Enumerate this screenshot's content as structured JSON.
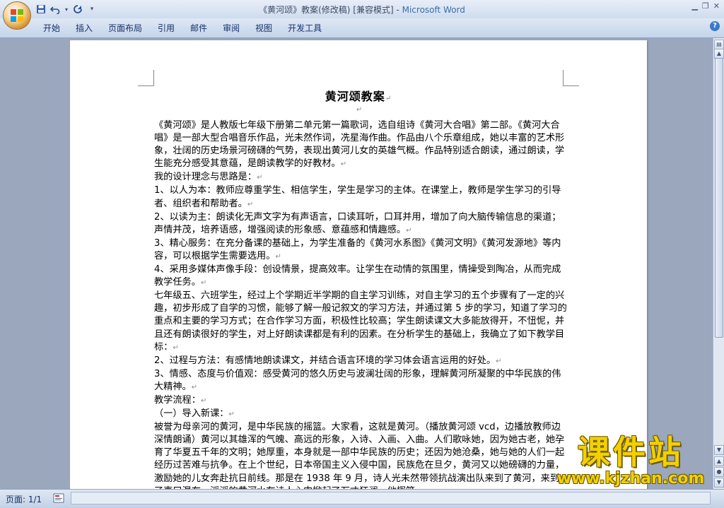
{
  "window": {
    "doc_name": "《黄河颂》教案(修改稿) [兼容模式] - ",
    "app_name": "Microsoft Word"
  },
  "ribbon": {
    "tabs": [
      "开始",
      "插入",
      "页面布局",
      "引用",
      "邮件",
      "审阅",
      "视图",
      "开发工具"
    ]
  },
  "icons": {
    "office_button": "office-logo-icon",
    "save": "save-icon",
    "undo": "undo-icon",
    "redo": "redo-icon",
    "customize": "customize-qat-icon",
    "help": "help-icon"
  },
  "document": {
    "title": "黄河颂教案",
    "paragraphs": [
      "《黄河颂》是人教版七年级下册第二单元第一篇歌词，选自组诗《黄河大合唱》第二部。《黄河大合唱》是一部大型合唱音乐作品，光未然作词，冼星海作曲。作品由八个乐章组成，她以丰富的艺术形象，壮阔的历史场景河磅礴的气势，表现出黄河儿女的英雄气概。作品特别适合朗读，通过朗读，学生能充分感受其意蕴，是朗读教学的好教材。",
      "我的设计理念与思路是：",
      "1、以人为本：教师应尊重学生、相信学生，学生是学习的主体。在课堂上，教师是学生学习的引导者、组织者和帮助者。",
      "2、以读为主：朗读化无声文字为有声语言，口读耳听，口耳并用，增加了向大脑传输信息的渠道；声情并茂，培养语感，增强阅读的形象感、意蕴感和情趣感。",
      "3、精心服务：在充分备课的基础上，为学生准备的《黄河水系图》《黄河文明》《黄河发源地》等内容，可以根据学生需要选用。",
      "4、采用多媒体声像手段：创设情景，提高效率。让学生在动情的氛围里，情操受到陶冶，从而完成教学任务。",
      "七年级五、六班学生，经过上个学期近半学期的自主学习训练，对自主学习的五个步骤有了一定的兴趣，初步形成了自学的习惯，能够了解一般记叙文的学习方法，并通过第 5 步的学习，知道了学习的重点和主要的学习方式；在合作学习方面，积极性比较高；学生朗读课文大多能放得开，不忸怩，并且还有朗读很好的学生，对上好朗读课都是有利的因素。在分析学生的基础上，我确立了如下教学目标：",
      "2、过程与方法：有感情地朗读课文，并结合语言环境的学习体会语言运用的好处。",
      "3、情感、态度与价值观：感受黄河的悠久历史与波澜壮阔的形象，理解黄河所凝聚的中华民族的伟大精神。",
      "教学流程：",
      "（一）导入新课：",
      "被誉为母亲河的黄河，是中华民族的摇篮。大家看，这就是黄河。（播放黄河颂 vcd，边播放教师边深情朗诵）黄河以其雄浑的气魄、高远的形象，入诗、入画、入曲。人们歌咏她，因为她古老，她孕育了华夏五千年的文明；她厚重，本身就是一部中华民族的历史；还因为她沧桑，她与她的人们一起经历过苦难与抗争。在上个世纪，日本帝国主义入侵中国，民族危在旦夕，黄河又以她磅礴的力量，激励她的儿女奔赴抗日前线。那是在 1938 年 9 月，诗人光未然带领抗战演出队来到了黄河，来到了壶口瀑布，滔滔的黄河水在诗人心中掀起了万丈狂澜，他挥笔"
    ]
  },
  "status": {
    "page": "页面: 1/1"
  },
  "watermark": {
    "main": "课件站",
    "url": "www.kjzhan.com"
  }
}
